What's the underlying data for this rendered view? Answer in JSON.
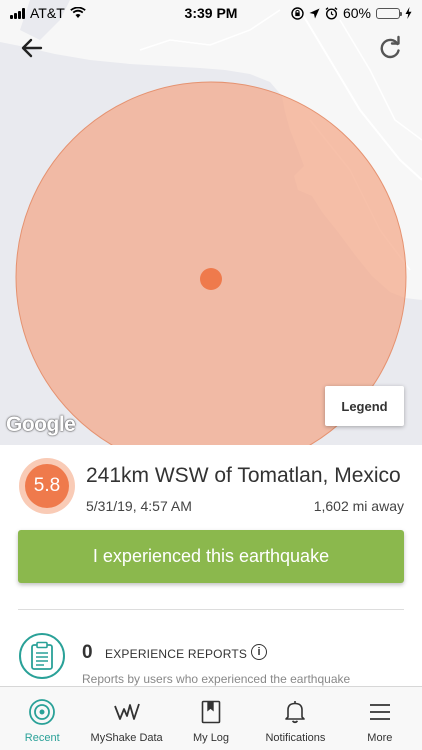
{
  "status_bar": {
    "carrier": "AT&T",
    "time": "3:39 PM",
    "battery_percent": "60%",
    "battery_level": 0.6,
    "icons": [
      "signal-icon",
      "wifi-icon",
      "orientation-lock-icon",
      "location-icon",
      "alarm-icon",
      "battery-icon",
      "charging-icon"
    ]
  },
  "map": {
    "legend_label": "Legend",
    "attribution": "Google",
    "circle_color": "#f4a888",
    "epicenter_color": "#ef7a4c"
  },
  "earthquake": {
    "magnitude": "5.8",
    "location": "241km WSW of Tomatlan, Mexico",
    "datetime": "5/31/19, 4:57 AM",
    "distance": "1,602 mi away"
  },
  "actions": {
    "experienced_label": "I experienced this earthquake"
  },
  "reports": {
    "count": "0",
    "label": "EXPERIENCE REPORTS",
    "description": "Reports by users who experienced the earthquake"
  },
  "colors": {
    "accent": "#2aa198",
    "action_green": "#8bb84d",
    "magnitude_orange": "#ef7a4c"
  },
  "tabs": [
    {
      "label": "Recent",
      "icon": "recent-icon",
      "active": true
    },
    {
      "label": "MyShake Data",
      "icon": "myshake-data-icon",
      "active": false
    },
    {
      "label": "My Log",
      "icon": "log-icon",
      "active": false
    },
    {
      "label": "Notifications",
      "icon": "bell-icon",
      "active": false
    },
    {
      "label": "More",
      "icon": "menu-icon",
      "active": false
    }
  ]
}
